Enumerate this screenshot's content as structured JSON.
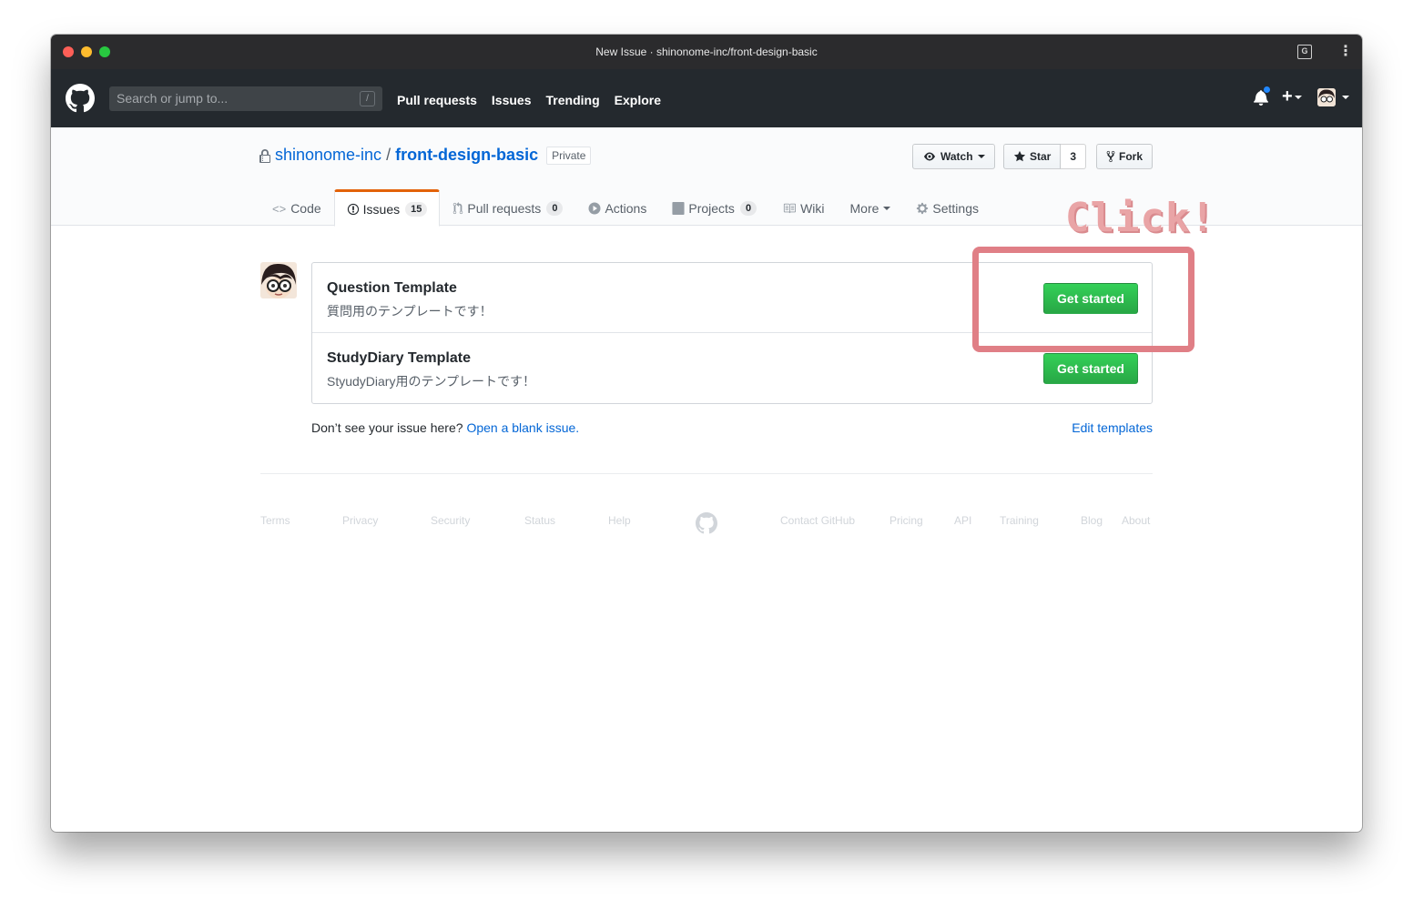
{
  "window": {
    "title": "New Issue · shinonome-inc/front-design-basic"
  },
  "header": {
    "search_placeholder": "Search or jump to...",
    "search_shortcut": "/",
    "nav": [
      "Pull requests",
      "Issues",
      "Trending",
      "Explore"
    ],
    "plus_label": "+"
  },
  "repo": {
    "owner": "shinonome-inc",
    "separator": "/",
    "name": "front-design-basic",
    "visibility": "Private",
    "watch_label": "Watch",
    "star_label": "Star",
    "star_count": "3",
    "fork_label": "Fork"
  },
  "tabs": [
    {
      "label": "Code",
      "icon": "code-icon"
    },
    {
      "label": "Issues",
      "icon": "issue-icon",
      "count": "15",
      "selected": true
    },
    {
      "label": "Pull requests",
      "icon": "pull-request-icon",
      "count": "0"
    },
    {
      "label": "Actions",
      "icon": "play-icon"
    },
    {
      "label": "Projects",
      "icon": "project-icon",
      "count": "0"
    },
    {
      "label": "Wiki",
      "icon": "book-icon"
    },
    {
      "label": "More",
      "icon": "caret-down-icon"
    },
    {
      "label": "Settings",
      "icon": "gear-icon"
    }
  ],
  "templates": [
    {
      "title": "Question Template",
      "description": "質問用のテンプレートです！",
      "button": "Get started"
    },
    {
      "title": "StudyDiary Template",
      "description": "StyudyDiary用のテンプレートです！",
      "button": "Get started"
    }
  ],
  "below": {
    "prompt": "Don’t see your issue here?",
    "blank_link": "Open a blank issue.",
    "edit_templates": "Edit templates"
  },
  "footer": [
    "Terms",
    "Privacy",
    "Security",
    "Status",
    "Help",
    "Contact GitHub",
    "Pricing",
    "API",
    "Training",
    "Blog",
    "About"
  ],
  "annotation": {
    "label": "Click!",
    "color": "#e07f86"
  },
  "colors": {
    "primary_green": "#28a745",
    "link_blue": "#0366d6",
    "selected_tab": "#e36209",
    "header_bg": "#24292e"
  }
}
